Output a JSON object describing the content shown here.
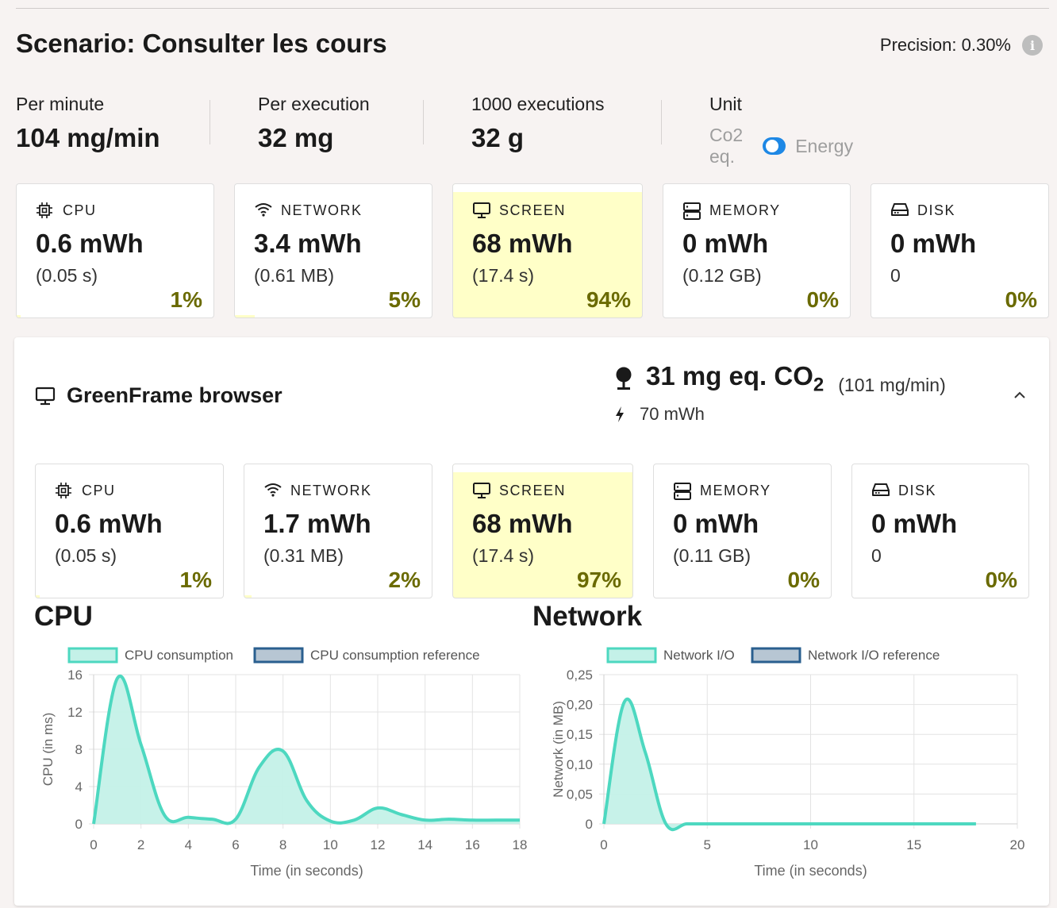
{
  "scenario": {
    "title": "Scenario: Consulter les cours",
    "precision": "Precision: 0.30%",
    "info_icon": "info-icon"
  },
  "stats": {
    "per_minute_label": "Per minute",
    "per_minute_value": "104 mg/min",
    "per_execution_label": "Per execution",
    "per_execution_value": "32 mg",
    "thousand_label": "1000 executions",
    "thousand_value": "32 g",
    "unit_label": "Unit",
    "unit_left": "Co2 eq.",
    "unit_right": "Energy",
    "unit_toggle_on": true
  },
  "summary_cards": [
    {
      "label": "CPU",
      "value": "0.6 mWh",
      "sub": "(0.05 s)",
      "pct": "1%",
      "share": 0.01,
      "icon": "cpu-chip-icon"
    },
    {
      "label": "NETWORK",
      "value": "3.4 mWh",
      "sub": "(0.61 MB)",
      "pct": "5%",
      "share": 0.05,
      "icon": "wifi-icon"
    },
    {
      "label": "SCREEN",
      "value": "68 mWh",
      "sub": "(17.4 s)",
      "pct": "94%",
      "share": 0.94,
      "icon": "monitor-icon"
    },
    {
      "label": "MEMORY",
      "value": "0 mWh",
      "sub": "(0.12 GB)",
      "pct": "0%",
      "share": 0,
      "icon": "memory-icon"
    },
    {
      "label": "DISK",
      "value": "0 mWh",
      "sub": "0",
      "pct": "0%",
      "share": 0,
      "icon": "disk-icon"
    }
  ],
  "browser": {
    "title": "GreenFrame browser",
    "co2_value": "31 mg eq. CO",
    "co2_subscript": "2",
    "co2_rate": "(101 mg/min)",
    "energy": "70 mWh",
    "cards": [
      {
        "label": "CPU",
        "value": "0.6 mWh",
        "sub": "(0.05 s)",
        "pct": "1%",
        "share": 0.01,
        "icon": "cpu-chip-icon"
      },
      {
        "label": "NETWORK",
        "value": "1.7 mWh",
        "sub": "(0.31 MB)",
        "pct": "2%",
        "share": 0.02,
        "icon": "wifi-icon"
      },
      {
        "label": "SCREEN",
        "value": "68 mWh",
        "sub": "(17.4 s)",
        "pct": "97%",
        "share": 0.97,
        "icon": "monitor-icon"
      },
      {
        "label": "MEMORY",
        "value": "0 mWh",
        "sub": "(0.11 GB)",
        "pct": "0%",
        "share": 0,
        "icon": "memory-icon"
      },
      {
        "label": "DISK",
        "value": "0 mWh",
        "sub": "0",
        "pct": "0%",
        "share": 0,
        "icon": "disk-icon"
      }
    ]
  },
  "colors": {
    "highlight": "#ffffc8",
    "series_line": "#4dd8c0",
    "series_fill": "#c4f1e8",
    "reference_border": "#2a5f8f",
    "reference_fill": "#b7c6d3",
    "pct_text": "#6a6a00"
  },
  "chart_data": [
    {
      "type": "area",
      "title": "CPU",
      "xlabel": "Time (in seconds)",
      "ylabel": "CPU (in ms)",
      "xlim": [
        0,
        18
      ],
      "ylim": [
        0,
        16
      ],
      "xticks": [
        "0",
        "2",
        "4",
        "6",
        "8",
        "10",
        "12",
        "14",
        "16",
        "18"
      ],
      "yticks": [
        "0",
        "4",
        "8",
        "12",
        "16"
      ],
      "grid": true,
      "legend_position": "top",
      "series": [
        {
          "name": "CPU consumption",
          "x": [
            0,
            1,
            2,
            3,
            4,
            5,
            6,
            7,
            8,
            9,
            10,
            11,
            12,
            13,
            14,
            15,
            16,
            17,
            18
          ],
          "values": [
            0,
            15.6,
            8.5,
            0.9,
            0.7,
            0.5,
            0.5,
            6.1,
            7.8,
            2.5,
            0.3,
            0.4,
            1.7,
            1.0,
            0.4,
            0.5,
            0.4,
            0.4,
            0.4
          ]
        },
        {
          "name": "CPU consumption reference",
          "x": [],
          "values": []
        }
      ]
    },
    {
      "type": "area",
      "title": "Network",
      "xlabel": "Time (in seconds)",
      "ylabel": "Network (in MB)",
      "xlim": [
        0,
        20
      ],
      "ylim": [
        0,
        0.25
      ],
      "xticks": [
        "0",
        "5",
        "10",
        "15",
        "20"
      ],
      "yticks": [
        "0",
        "0,05",
        "0,10",
        "0,15",
        "0,20",
        "0,25"
      ],
      "grid": true,
      "legend_position": "top",
      "series": [
        {
          "name": "Network I/O",
          "x": [
            0,
            1,
            2,
            3,
            4,
            5,
            6,
            7,
            8,
            9,
            10,
            11,
            12,
            13,
            14,
            15,
            16,
            17,
            18
          ],
          "values": [
            0,
            0.205,
            0.12,
            0,
            0,
            0,
            0,
            0,
            0,
            0,
            0,
            0,
            0,
            0,
            0,
            0,
            0,
            0,
            0
          ]
        },
        {
          "name": "Network I/O reference",
          "x": [],
          "values": []
        }
      ]
    }
  ]
}
